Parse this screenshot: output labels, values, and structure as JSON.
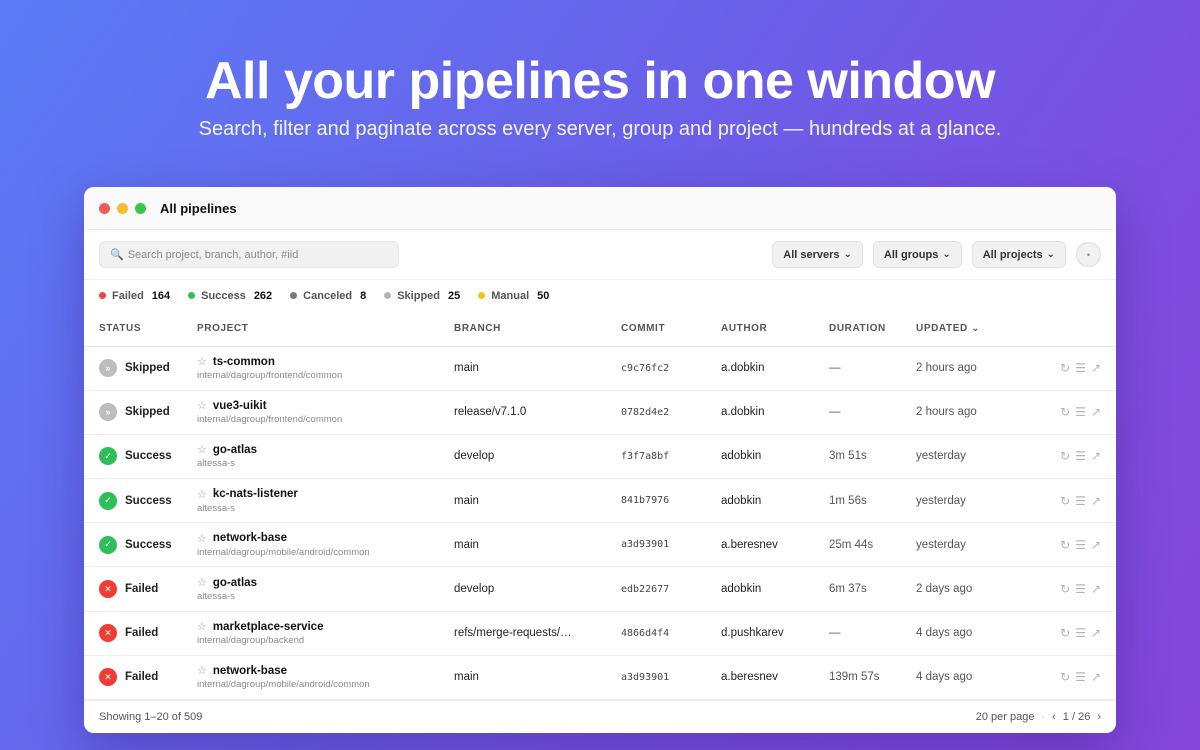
{
  "hero": {
    "title": "All your pipelines in one window",
    "subtitle": "Search, filter and paginate across every server, group and project — hundreds at a glance."
  },
  "window": {
    "title": "All pipelines",
    "traffic_lights": [
      "#ee5c57",
      "#f4bd34",
      "#34c749"
    ]
  },
  "toolbar": {
    "search_icon": "🔍",
    "search_placeholder": "Search project, branch, author, #iid",
    "filters": [
      {
        "label": "All servers",
        "chevron": "⌄"
      },
      {
        "label": "All groups",
        "chevron": "⌄"
      },
      {
        "label": "All projects",
        "chevron": "⌄"
      }
    ],
    "refresh_icon": "•"
  },
  "counts": [
    {
      "label": "Failed",
      "value": "164",
      "color": "#f0443a"
    },
    {
      "label": "Success",
      "value": "262",
      "color": "#2fbf5a"
    },
    {
      "label": "Canceled",
      "value": "8",
      "color": "#7a7a7a"
    },
    {
      "label": "Skipped",
      "value": "25",
      "color": "#b5b5b5"
    },
    {
      "label": "Manual",
      "value": "50",
      "color": "#f2c418"
    }
  ],
  "table": {
    "headers": [
      "STATUS",
      "PROJECT",
      "BRANCH",
      "COMMIT",
      "AUTHOR",
      "DURATION",
      "UPDATED ⌄"
    ],
    "status_styles": {
      "Skipped": {
        "glyph": "»",
        "color": "#bdbdbd"
      },
      "Success": {
        "glyph": "✓",
        "color": "#2fbf5a"
      },
      "Failed": {
        "glyph": "✕",
        "color": "#ef3d34"
      }
    },
    "star": "☆",
    "actions": [
      "↻",
      "☰",
      "↗"
    ],
    "rows": [
      {
        "status": "Skipped",
        "project": "ts-common",
        "path": "internal/dagroup/frontend/common",
        "branch": "main",
        "commit": "c9c76fc2",
        "author": "a.dobkin",
        "duration": "—",
        "updated": "2 hours ago"
      },
      {
        "status": "Skipped",
        "project": "vue3-uikit",
        "path": "internal/dagroup/frontend/common",
        "branch": "release/v7.1.0",
        "commit": "0782d4e2",
        "author": "a.dobkin",
        "duration": "—",
        "updated": "2 hours ago"
      },
      {
        "status": "Success",
        "project": "go-atlas",
        "path": "altessa-s",
        "branch": "develop",
        "commit": "f3f7a8bf",
        "author": "adobkin",
        "duration": "3m 51s",
        "updated": "yesterday"
      },
      {
        "status": "Success",
        "project": "kc-nats-listener",
        "path": "altessa-s",
        "branch": "main",
        "commit": "841b7976",
        "author": "adobkin",
        "duration": "1m 56s",
        "updated": "yesterday"
      },
      {
        "status": "Success",
        "project": "network-base",
        "path": "internal/dagroup/mobile/android/common",
        "branch": "main",
        "commit": "a3d93901",
        "author": "a.beresnev",
        "duration": "25m 44s",
        "updated": "yesterday"
      },
      {
        "status": "Failed",
        "project": "go-atlas",
        "path": "altessa-s",
        "branch": "develop",
        "commit": "edb22677",
        "author": "adobkin",
        "duration": "6m 37s",
        "updated": "2 days ago"
      },
      {
        "status": "Failed",
        "project": "marketplace-service",
        "path": "internal/dagroup/backend",
        "branch": "refs/merge-requests/…",
        "commit": "4866d4f4",
        "author": "d.pushkarev",
        "duration": "—",
        "updated": "4 days ago"
      },
      {
        "status": "Failed",
        "project": "network-base",
        "path": "internal/dagroup/mobile/android/common",
        "branch": "main",
        "commit": "a3d93901",
        "author": "a.beresnev",
        "duration": "139m 57s",
        "updated": "4 days ago"
      }
    ]
  },
  "footer": {
    "showing": "Showing 1–20 of 509",
    "per_page": "20 per page",
    "separator": "·",
    "prev": "‹",
    "page": "1 / 26",
    "next": "›"
  }
}
